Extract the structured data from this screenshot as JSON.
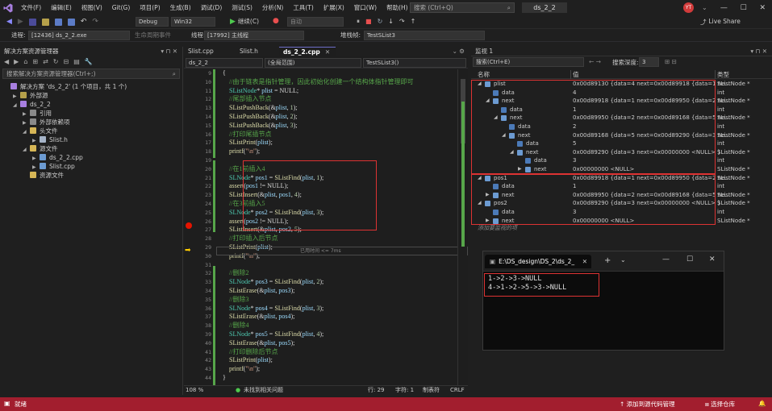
{
  "menu": [
    "文件(F)",
    "编辑(E)",
    "视图(V)",
    "Git(G)",
    "项目(P)",
    "生成(B)",
    "调试(D)",
    "测试(S)",
    "分析(N)",
    "工具(T)",
    "扩展(X)",
    "窗口(W)",
    "帮助(H)"
  ],
  "search_placeholder": "搜索 (Ctrl+Q)",
  "project_name": "ds_2_2",
  "avatar_initials": "YT",
  "live_share": "Live Share",
  "toolbar": {
    "config": "Debug",
    "platform": "Win32",
    "continue": "继续(C)",
    "auto": "自动"
  },
  "toolbar2": {
    "process_label": "进程:",
    "process_value": "[12436] ds_2_2.exe",
    "lifecycle_label": "生命周期事件",
    "thread_label": "线程:",
    "thread_value": "[17992] 主线程",
    "stack_label": "堆栈帧:",
    "stack_value": "TestSList3"
  },
  "solution_explorer": {
    "title": "解决方案资源管理器",
    "search": "搜索解决方案资源管理器(Ctrl+;)",
    "items": [
      {
        "label": "解决方案 'ds_2_2' (1 个项目，共 1 个)",
        "indent": 0,
        "arrow": ""
      },
      {
        "label": "外部源",
        "indent": 1,
        "arrow": "▶"
      },
      {
        "label": "ds_2_2",
        "indent": 1,
        "arrow": "◢"
      },
      {
        "label": "引用",
        "indent": 2,
        "arrow": "▶"
      },
      {
        "label": "外部依赖项",
        "indent": 2,
        "arrow": "▶"
      },
      {
        "label": "头文件",
        "indent": 2,
        "arrow": "◢"
      },
      {
        "label": "Slist.h",
        "indent": 3,
        "arrow": "▶"
      },
      {
        "label": "源文件",
        "indent": 2,
        "arrow": "◢"
      },
      {
        "label": "ds_2_2.cpp",
        "indent": 3,
        "arrow": "▶"
      },
      {
        "label": "Slist.cpp",
        "indent": 3,
        "arrow": "▶"
      },
      {
        "label": "资源文件",
        "indent": 2,
        "arrow": ""
      }
    ]
  },
  "editor": {
    "tabs": [
      "Slist.cpp",
      "Slist.h",
      "ds_2_2.cpp"
    ],
    "nav_project": "ds_2_2",
    "nav_scope": "(全局范围)",
    "nav_func": "TestSList3()",
    "zoom": "108 %",
    "issues": "未找到相关问题",
    "row": "行: 29",
    "char": "字符: 1",
    "tab_mode": "制表符",
    "eol": "CRLF",
    "inline_hint": "已用时间 <= 7ms",
    "lines": [
      {
        "n": "9",
        "segs": [
          [
            "pl",
            "{"
          ]
        ]
      },
      {
        "n": "10",
        "segs": [
          [
            "cm",
            "    //由于链表是指针管理，因此初始化创建一个结构体指针管理即可"
          ]
        ]
      },
      {
        "n": "11",
        "segs": [
          [
            "ty",
            "    SListNode"
          ],
          [
            "pl",
            "* "
          ],
          [
            "var",
            "plist"
          ],
          [
            "pl",
            " = NULL;"
          ]
        ]
      },
      {
        "n": "12",
        "segs": [
          [
            "cm",
            "    //尾部插入节点"
          ]
        ]
      },
      {
        "n": "13",
        "segs": [
          [
            "fn",
            "    SListPushBack"
          ],
          [
            "pl",
            "(&"
          ],
          [
            "var",
            "plist"
          ],
          [
            "pl",
            ", "
          ],
          [
            "num",
            "1"
          ],
          [
            "pl",
            ");"
          ]
        ]
      },
      {
        "n": "14",
        "segs": [
          [
            "fn",
            "    SListPushBack"
          ],
          [
            "pl",
            "(&"
          ],
          [
            "var",
            "plist"
          ],
          [
            "pl",
            ", "
          ],
          [
            "num",
            "2"
          ],
          [
            "pl",
            ");"
          ]
        ]
      },
      {
        "n": "15",
        "segs": [
          [
            "fn",
            "    SListPushBack"
          ],
          [
            "pl",
            "(&"
          ],
          [
            "var",
            "plist"
          ],
          [
            "pl",
            ", "
          ],
          [
            "num",
            "3"
          ],
          [
            "pl",
            ");"
          ]
        ]
      },
      {
        "n": "16",
        "segs": [
          [
            "cm",
            "    //打印尾插节点"
          ]
        ]
      },
      {
        "n": "17",
        "segs": [
          [
            "fn",
            "    SListPrint"
          ],
          [
            "pl",
            "("
          ],
          [
            "var",
            "plist"
          ],
          [
            "pl",
            ");"
          ]
        ]
      },
      {
        "n": "18",
        "segs": [
          [
            "fn",
            "    printf"
          ],
          [
            "pl",
            "("
          ],
          [
            "str",
            "\"\\n\""
          ],
          [
            "pl",
            ");"
          ]
        ]
      },
      {
        "n": "19",
        "segs": [
          [
            "pl",
            ""
          ]
        ]
      },
      {
        "n": "20",
        "segs": [
          [
            "cm",
            "    //在1前插入4"
          ]
        ]
      },
      {
        "n": "21",
        "segs": [
          [
            "ty",
            "    SLNode"
          ],
          [
            "pl",
            "* "
          ],
          [
            "var",
            "pos1"
          ],
          [
            "pl",
            " = "
          ],
          [
            "fn",
            "SListFind"
          ],
          [
            "pl",
            "("
          ],
          [
            "var",
            "plist"
          ],
          [
            "pl",
            ", "
          ],
          [
            "num",
            "1"
          ],
          [
            "pl",
            ");"
          ]
        ]
      },
      {
        "n": "22",
        "segs": [
          [
            "fn",
            "    assert"
          ],
          [
            "pl",
            "("
          ],
          [
            "var",
            "pos1"
          ],
          [
            "pl",
            " != NULL);"
          ]
        ]
      },
      {
        "n": "23",
        "segs": [
          [
            "fn",
            "    SListInsert"
          ],
          [
            "pl",
            "(&"
          ],
          [
            "var",
            "plist"
          ],
          [
            "pl",
            ", "
          ],
          [
            "var",
            "pos1"
          ],
          [
            "pl",
            ", "
          ],
          [
            "num",
            "4"
          ],
          [
            "pl",
            ");"
          ]
        ]
      },
      {
        "n": "24",
        "segs": [
          [
            "cm",
            "    //在3前插入5"
          ]
        ]
      },
      {
        "n": "25",
        "segs": [
          [
            "ty",
            "    SLNode"
          ],
          [
            "pl",
            "* "
          ],
          [
            "var",
            "pos2"
          ],
          [
            "pl",
            " = "
          ],
          [
            "fn",
            "SListFind"
          ],
          [
            "pl",
            "("
          ],
          [
            "var",
            "plist"
          ],
          [
            "pl",
            ", "
          ],
          [
            "num",
            "3"
          ],
          [
            "pl",
            ");"
          ]
        ]
      },
      {
        "n": "26",
        "segs": [
          [
            "fn",
            "    assert"
          ],
          [
            "pl",
            "("
          ],
          [
            "var",
            "pos2"
          ],
          [
            "pl",
            " != NULL);"
          ]
        ]
      },
      {
        "n": "27",
        "segs": [
          [
            "fn",
            "    SListInsert"
          ],
          [
            "pl",
            "(&"
          ],
          [
            "var",
            "plist"
          ],
          [
            "pl",
            ", "
          ],
          [
            "var",
            "pos2"
          ],
          [
            "pl",
            ", "
          ],
          [
            "num",
            "5"
          ],
          [
            "pl",
            ");"
          ]
        ]
      },
      {
        "n": "28",
        "segs": [
          [
            "cm",
            "    //打印插入后节点"
          ]
        ]
      },
      {
        "n": "29",
        "segs": [
          [
            "fn",
            "    SListPrint"
          ],
          [
            "pl",
            "("
          ],
          [
            "var",
            "plist"
          ],
          [
            "pl",
            ");"
          ]
        ]
      },
      {
        "n": "30",
        "segs": [
          [
            "fn",
            "    printf"
          ],
          [
            "pl",
            "("
          ],
          [
            "str",
            "\"\\n\""
          ],
          [
            "pl",
            ");"
          ]
        ]
      },
      {
        "n": "31",
        "segs": [
          [
            "pl",
            ""
          ]
        ]
      },
      {
        "n": "32",
        "segs": [
          [
            "cm",
            "    //删除2"
          ]
        ]
      },
      {
        "n": "33",
        "segs": [
          [
            "ty",
            "    SLNode"
          ],
          [
            "pl",
            "* "
          ],
          [
            "var",
            "pos3"
          ],
          [
            "pl",
            " = "
          ],
          [
            "fn",
            "SListFind"
          ],
          [
            "pl",
            "("
          ],
          [
            "var",
            "plist"
          ],
          [
            "pl",
            ", "
          ],
          [
            "num",
            "2"
          ],
          [
            "pl",
            ");"
          ]
        ]
      },
      {
        "n": "34",
        "segs": [
          [
            "fn",
            "    SListErase"
          ],
          [
            "pl",
            "(&"
          ],
          [
            "var",
            "plist"
          ],
          [
            "pl",
            ", "
          ],
          [
            "var",
            "pos3"
          ],
          [
            "pl",
            ");"
          ]
        ]
      },
      {
        "n": "35",
        "segs": [
          [
            "cm",
            "    //删除3"
          ]
        ]
      },
      {
        "n": "36",
        "segs": [
          [
            "ty",
            "    SLNode"
          ],
          [
            "pl",
            "* "
          ],
          [
            "var",
            "pos4"
          ],
          [
            "pl",
            " = "
          ],
          [
            "fn",
            "SListFind"
          ],
          [
            "pl",
            "("
          ],
          [
            "var",
            "plist"
          ],
          [
            "pl",
            ", "
          ],
          [
            "num",
            "3"
          ],
          [
            "pl",
            ");"
          ]
        ]
      },
      {
        "n": "37",
        "segs": [
          [
            "fn",
            "    SListErase"
          ],
          [
            "pl",
            "(&"
          ],
          [
            "var",
            "plist"
          ],
          [
            "pl",
            ", "
          ],
          [
            "var",
            "pos4"
          ],
          [
            "pl",
            ");"
          ]
        ]
      },
      {
        "n": "38",
        "segs": [
          [
            "cm",
            "    //删除4"
          ]
        ]
      },
      {
        "n": "39",
        "segs": [
          [
            "ty",
            "    SLNode"
          ],
          [
            "pl",
            "* "
          ],
          [
            "var",
            "pos5"
          ],
          [
            "pl",
            " = "
          ],
          [
            "fn",
            "SListFind"
          ],
          [
            "pl",
            "("
          ],
          [
            "var",
            "plist"
          ],
          [
            "pl",
            ", "
          ],
          [
            "num",
            "4"
          ],
          [
            "pl",
            ");"
          ]
        ]
      },
      {
        "n": "40",
        "segs": [
          [
            "fn",
            "    SListErase"
          ],
          [
            "pl",
            "(&"
          ],
          [
            "var",
            "plist"
          ],
          [
            "pl",
            ", "
          ],
          [
            "var",
            "pos5"
          ],
          [
            "pl",
            ");"
          ]
        ]
      },
      {
        "n": "41",
        "segs": [
          [
            "cm",
            "    //打印删除后节点"
          ]
        ]
      },
      {
        "n": "42",
        "segs": [
          [
            "fn",
            "    SListPrint"
          ],
          [
            "pl",
            "("
          ],
          [
            "var",
            "plist"
          ],
          [
            "pl",
            ");"
          ]
        ]
      },
      {
        "n": "43",
        "segs": [
          [
            "fn",
            "    printf"
          ],
          [
            "pl",
            "("
          ],
          [
            "str",
            "\"\\n\""
          ],
          [
            "pl",
            ");"
          ]
        ]
      },
      {
        "n": "44",
        "segs": [
          [
            "pl",
            "}"
          ]
        ]
      }
    ]
  },
  "watch": {
    "title": "监视 1",
    "search": "搜索(Ctrl+E)",
    "depth_label": "搜索深度:",
    "depth_value": "3",
    "col_name": "名称",
    "col_value": "值",
    "col_type": "类型",
    "add_hint": "添加要监视的项",
    "rows": [
      {
        "d": 0,
        "ex": "◢",
        "ic": true,
        "name": "plist",
        "value": "0x00d89130 {data=4 next=0x00d89918 {data=1 ne...",
        "type": "SListNode *"
      },
      {
        "d": 1,
        "ex": "",
        "ic": false,
        "name": "data",
        "value": "4",
        "type": "int"
      },
      {
        "d": 1,
        "ex": "◢",
        "ic": true,
        "name": "next",
        "value": "0x00d89918 {data=1 next=0x00d89950 {data=2 ne...",
        "type": "SListNode *"
      },
      {
        "d": 2,
        "ex": "",
        "ic": false,
        "name": "data",
        "value": "1",
        "type": "int"
      },
      {
        "d": 2,
        "ex": "◢",
        "ic": true,
        "name": "next",
        "value": "0x00d89950 {data=2 next=0x00d89168 {data=5 ne...",
        "type": "SListNode *"
      },
      {
        "d": 3,
        "ex": "",
        "ic": false,
        "name": "data",
        "value": "2",
        "type": "int"
      },
      {
        "d": 3,
        "ex": "◢",
        "ic": true,
        "name": "next",
        "value": "0x00d89168 {data=5 next=0x00d89290 {data=3 ne...",
        "type": "SListNode *"
      },
      {
        "d": 4,
        "ex": "",
        "ic": false,
        "name": "data",
        "value": "5",
        "type": "int"
      },
      {
        "d": 4,
        "ex": "◢",
        "ic": true,
        "name": "next",
        "value": "0x00d89290 {data=3 next=0x00000000 <NULL> }",
        "type": "SListNode *"
      },
      {
        "d": 5,
        "ex": "",
        "ic": false,
        "name": "data",
        "value": "3",
        "type": "int"
      },
      {
        "d": 5,
        "ex": "▶",
        "ic": true,
        "name": "next",
        "value": "0x00000000 <NULL>",
        "type": "SListNode *"
      },
      {
        "d": 0,
        "ex": "◢",
        "ic": true,
        "name": "pos1",
        "value": "0x00d89918 {data=1 next=0x00d89950 {data=2 ne...",
        "type": "SListNode *"
      },
      {
        "d": 1,
        "ex": "",
        "ic": false,
        "name": "data",
        "value": "1",
        "type": "int"
      },
      {
        "d": 1,
        "ex": "▶",
        "ic": true,
        "name": "next",
        "value": "0x00d89950 {data=2 next=0x00d89168 {data=5 ne...",
        "type": "SListNode *"
      },
      {
        "d": 0,
        "ex": "◢",
        "ic": true,
        "name": "pos2",
        "value": "0x00d89290 {data=3 next=0x00000000 <NULL> }",
        "type": "SListNode *"
      },
      {
        "d": 1,
        "ex": "",
        "ic": false,
        "name": "data",
        "value": "3",
        "type": "int"
      },
      {
        "d": 1,
        "ex": "▶",
        "ic": true,
        "name": "next",
        "value": "0x00000000 <NULL>",
        "type": "SListNode *"
      }
    ]
  },
  "console": {
    "title": "E:\\DS_design\\DS_2\\ds_2_",
    "lines": [
      "1->2->3->NULL",
      "4->1->2->5->3->NULL"
    ]
  },
  "status": {
    "ready": "就绪",
    "source_control": "添加到源代码管理",
    "repo": "选择仓库"
  }
}
